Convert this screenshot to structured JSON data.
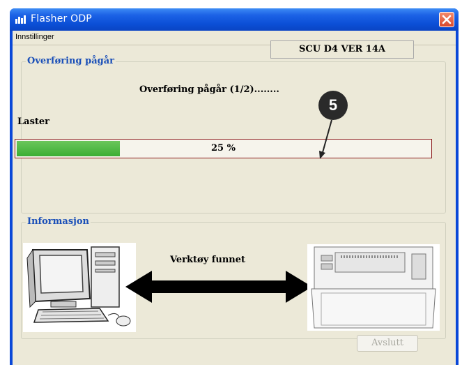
{
  "window": {
    "title": "Flasher ODP"
  },
  "menu": {
    "items": [
      "Innstillinger"
    ]
  },
  "transfer": {
    "group_title": "Overføring pågår",
    "version": "SCU D4 VER  14A",
    "status": "Overføring pågår (1/2)........",
    "progress_label_text": "Laster",
    "progress_percent": 25,
    "progress_text": "25 %"
  },
  "callout": {
    "number": "5"
  },
  "info": {
    "group_title": "Informasjon",
    "status": "Verktøy funnet"
  },
  "buttons": {
    "exit_label": "Avslutt"
  },
  "colors": {
    "title_bar": "#0b4fd6",
    "progress_fill": "#3cae35",
    "group_title": "#1a4fb8",
    "progress_border": "#8b1a1a"
  }
}
